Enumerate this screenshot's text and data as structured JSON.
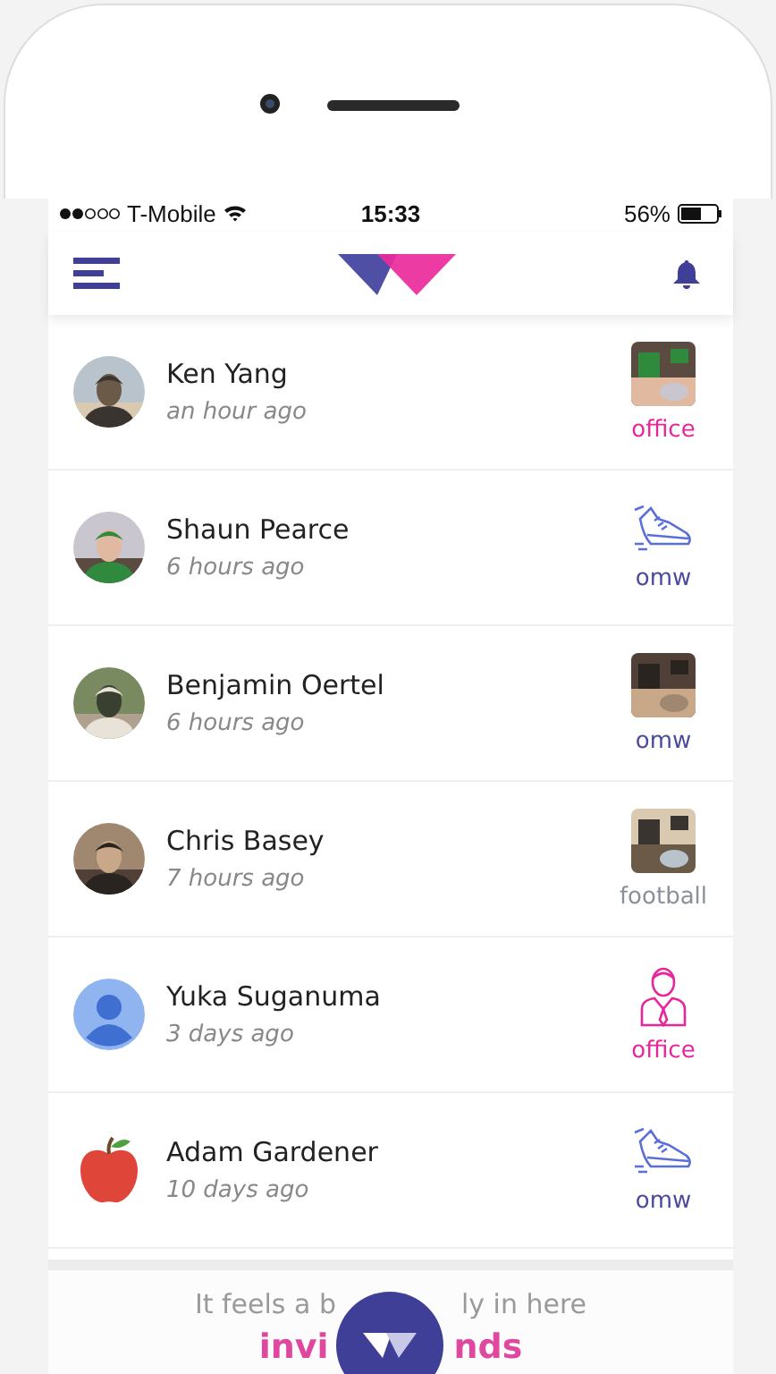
{
  "status_bar": {
    "carrier": "T-Mobile",
    "time": "15:33",
    "battery": "56%"
  },
  "feed": [
    {
      "name": "Ken Yang",
      "time": "an hour ago",
      "activity": {
        "label": "office",
        "color": "#e8269b"
      }
    },
    {
      "name": "Shaun Pearce",
      "time": "6 hours ago",
      "activity": {
        "kind": "shoe",
        "label": "omw",
        "color": "#4a4a9e"
      }
    },
    {
      "name": "Benjamin Oertel",
      "time": "6 hours ago",
      "activity": {
        "label": "omw",
        "color": "#4a4a9e"
      }
    },
    {
      "name": "Chris Basey",
      "time": "7 hours ago",
      "activity": {
        "label": "football",
        "color": "#8a8f99"
      }
    },
    {
      "name": "Yuka Suganuma",
      "time": "3 days ago",
      "avatar": {
        "kind": "default"
      },
      "activity": {
        "kind": "person",
        "label": "office",
        "color": "#e8269b"
      }
    },
    {
      "name": "Adam Gardener",
      "time": "10 days ago",
      "avatar": {
        "kind": "apple"
      },
      "activity": {
        "kind": "shoe",
        "label": "omw",
        "color": "#4a4a9e"
      }
    }
  ],
  "empty_state": {
    "message_left": "It feels a b",
    "message_right": "ly in here",
    "link_left": "invi",
    "link_right": "nds"
  }
}
